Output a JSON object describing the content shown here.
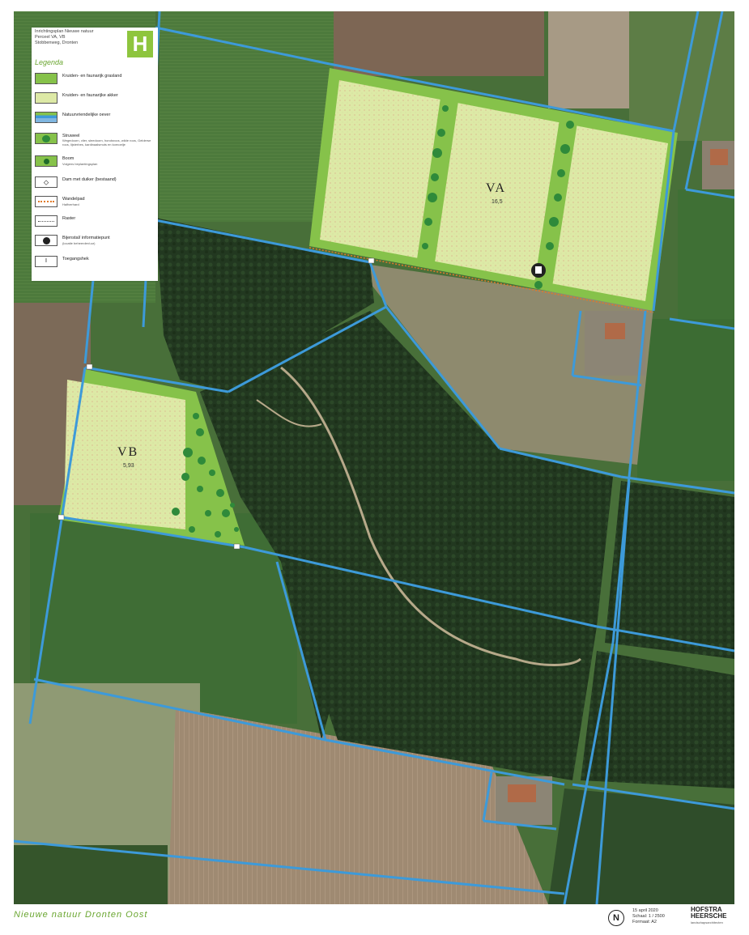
{
  "legend": {
    "header": [
      "Inrichtingsplan Nieuwe natuur",
      "Perceel VA, VB",
      "Stobbenweg, Dronten"
    ],
    "logo": "H",
    "heading": "Legenda",
    "items": [
      {
        "label": "Kruiden- en faunarijk grasland",
        "sub": "",
        "swatch": "grassland"
      },
      {
        "label": "Kruiden- en faunarijke akker",
        "sub": "",
        "swatch": "field"
      },
      {
        "label": "Natuurvriendelijke oever",
        "sub": "",
        "swatch": "bank"
      },
      {
        "label": "Struweel",
        "sub": "Wegedoorn, vlier, sleedoorn, hondsroos, wilde roos, Gelderse roos, lijsterbes, kardinaalsmuts en kornoelje",
        "swatch": "shrub"
      },
      {
        "label": "Boom",
        "sub": "Volgens beplantingsplan",
        "swatch": "tree"
      },
      {
        "label": "Dam met duiker (bestaand)",
        "sub": "",
        "swatch": "dam"
      },
      {
        "label": "Wandelpad",
        "sub": "Halfverhard",
        "swatch": "path"
      },
      {
        "label": "Raster",
        "sub": "",
        "swatch": "fence"
      },
      {
        "label": "Bijenstal/ informatiepunt",
        "sub": "(locatie beheerder/uur)",
        "swatch": "info"
      },
      {
        "label": "Toegangshek",
        "sub": "",
        "swatch": "gate"
      }
    ]
  },
  "parcels": [
    {
      "code": "VA",
      "area": "16,5"
    },
    {
      "code": "VB",
      "area": "5,93"
    }
  ],
  "footer": {
    "title": "Nieuwe natuur Dronten Oost",
    "north": "N",
    "date": "15 april 2020",
    "scale": "Schaal: 1 / 2500",
    "format": "Formaat: A2",
    "firm_line1": "HOFSTRA",
    "firm_line2": "HEERSCHE",
    "firm_sub": "landschapsarchitecten"
  },
  "colors": {
    "water": "#3d9ad9",
    "grassland": "#86c24a",
    "field": "#dde9a6",
    "forest": "#243a22",
    "shrub": "#2f8a3a",
    "path": "#e07a2a"
  }
}
